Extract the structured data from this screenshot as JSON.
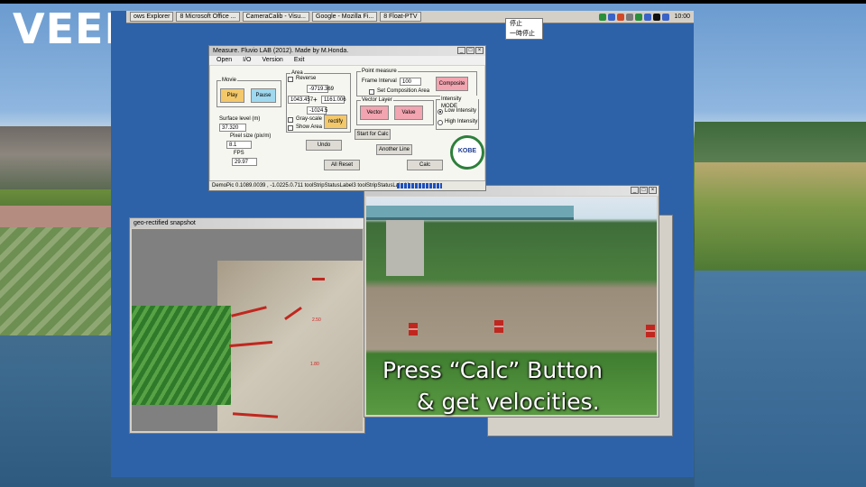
{
  "branding": {
    "logo_text": "VEED"
  },
  "taskbar": {
    "tasks": [
      "ows Explorer",
      "8 Microsoft Office ...",
      "CameraCalib - Visu...",
      "Google - Mozilla Fi...",
      "8 Float-PTV"
    ],
    "clock": "10:00",
    "tray_menu": [
      "停止",
      "一時停止"
    ]
  },
  "main_window": {
    "title": "Measure.  Fluvio LAB (2012). Made by M.Honda.",
    "menu": [
      "Open",
      "I/O",
      "Version",
      "Exit"
    ],
    "movie": {
      "label": "Movie",
      "play": "Play",
      "pause": "Pause"
    },
    "surface_level_label": "Surface level (m)",
    "surface_level_value": "37.320",
    "pixel_size_label": "Pixel size (pix/m)",
    "pixel_size_value": "8.1",
    "fps_label": "FPS",
    "fps_value": "29.97",
    "area": {
      "label": "Area",
      "reverse_label": "Reverse",
      "top_value": "-9719.369",
      "left_value": "1043.457",
      "right_value": "1161.006",
      "bottom_value": "-1024.5",
      "grayscale_label": "Gray-scale",
      "show_area_label": "Show Area",
      "rectify_button": "rectify"
    },
    "undo_button": "Undo",
    "all_reset_button": "All Reset",
    "point_measure": {
      "label": "Point measure",
      "frame_interval_label": "Frame Interval",
      "frame_interval_value": "100",
      "composite_button": "Composite",
      "set_composition_label": "Set Composition Area"
    },
    "vector_layer": {
      "label": "Vector Layer",
      "vector_button": "Vector",
      "value_button": "Value"
    },
    "intensity_mode": {
      "label": "Intensity MODE",
      "low_label": "Low Intensity",
      "high_label": "High Intensity"
    },
    "start_calc_button": "Start for Calc",
    "another_line_button": "Another Line",
    "calc_button": "Calc",
    "logo_text": "KOBE",
    "status_text": "DemoPic  0.1089.0039 , -1.0225.0.711  toolStripStatusLabel3  toolStripStatusLabel4"
  },
  "snapshot_window": {
    "title": "geo-rectified snapshot",
    "labels": [
      "2.50",
      "1.80"
    ]
  },
  "video_window": {
    "caption_line1": "Press “Calc” Button",
    "caption_line2": "& get velocities."
  },
  "colors": {
    "desktop": "#2e62a8",
    "accent_red": "#c0271f"
  }
}
